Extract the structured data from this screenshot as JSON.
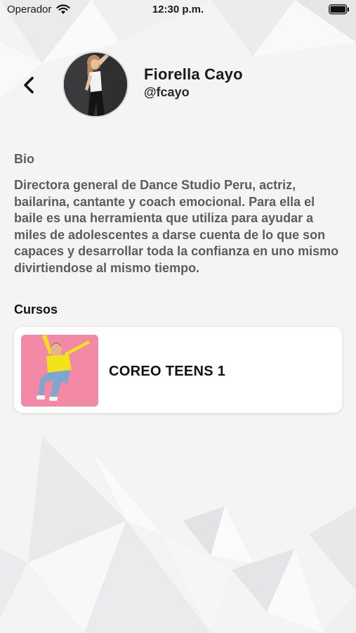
{
  "status_bar": {
    "carrier": "Operador",
    "time": "12:30 p.m."
  },
  "profile": {
    "name": "Fiorella Cayo",
    "handle": "@fcayo"
  },
  "bio": {
    "heading": "Bio",
    "text": "Directora general de Dance Studio Peru, actriz, bailarina, cantante y coach emocional. Para ella el baile es una herramienta que utiliza para ayudar a miles de adolescentes a darse cuenta de lo que son capaces y desarrollar toda la confianza en uno mismo divirtiendose al mismo tiempo."
  },
  "courses": {
    "heading": "Cursos",
    "items": [
      {
        "title": "COREO TEENS 1"
      }
    ]
  },
  "colors": {
    "background": "#f4f4f5",
    "card": "#ffffff",
    "bio_text": "#5c5c5c",
    "course_thumb": "#f28aa5"
  }
}
